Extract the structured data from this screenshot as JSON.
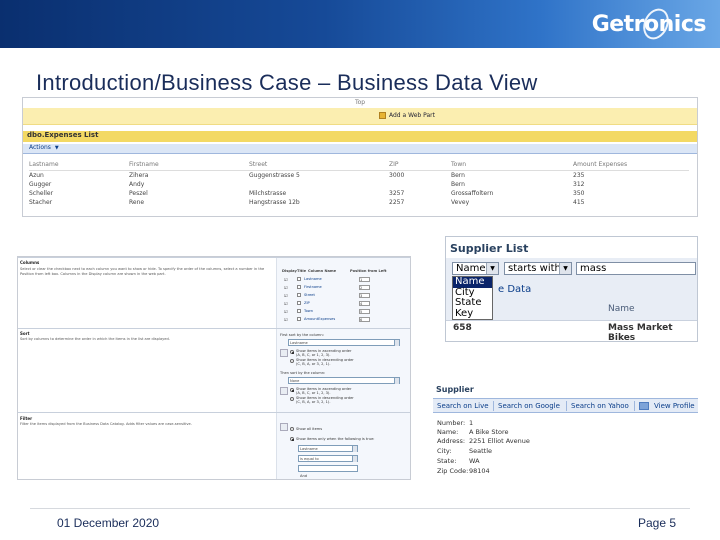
{
  "header": {
    "logo": "Getronics",
    "brand_color": "#164a98"
  },
  "slide": {
    "title": "Introduction/Business Case – Business Data View"
  },
  "expenses_panel": {
    "top_label": "Top",
    "add_webpart": "Add a Web Part",
    "list_title": "dbo.Expenses List",
    "actions": "Actions",
    "columns": [
      "Lastname",
      "Firstname",
      "Street",
      "ZIP",
      "Town",
      "Amount Expenses"
    ],
    "rows": [
      [
        "Azun",
        "Zihera",
        "Guggenstrasse 5",
        "3000",
        "Bern",
        "235"
      ],
      [
        "Gugger",
        "Andy",
        "",
        "",
        "Bern",
        "312"
      ],
      [
        "Scheller",
        "Peszel",
        "Milchstrasse",
        "3257",
        "Grossaffoltern",
        "350"
      ],
      [
        "Stacher",
        "Rene",
        "Hangstrasse 12b",
        "2257",
        "Vevey",
        "415"
      ]
    ]
  },
  "settings_panel": {
    "sec1_title": "Columns",
    "sec1_desc": "Select or clear the checkbox next to each column you want to show or hide. To specify the order of the columns, select a number in the Position from left box. Columns in the Display column are shown in the web part.",
    "col_headers": [
      "Display",
      "Title",
      "Column Name",
      "Position from Left"
    ],
    "columns": [
      {
        "name": "Lastname",
        "pos": "1"
      },
      {
        "name": "Firstname",
        "pos": "2"
      },
      {
        "name": "Street",
        "pos": "3"
      },
      {
        "name": "ZIP",
        "pos": "4"
      },
      {
        "name": "Town",
        "pos": "5"
      },
      {
        "name": "AmountExpenses",
        "pos": "6"
      }
    ],
    "sec2_title": "Sort",
    "sec2_desc": "Sort by columns to determine the order in which the items in the list are displayed.",
    "primary_label": "First sort by the column:",
    "primary_value": "Lastname",
    "asc_label": "Show items in ascending order (A, B, C, or 1, 2, 3).",
    "desc_label": "Show items in descending order (C, B, A, or 3, 2, 1).",
    "secondary_label": "Then sort by the column:",
    "secondary_value": "None",
    "sec3_title": "Filter",
    "sec3_desc": "Filter the items displayed from the Business Data Catalog. Adds filter values are case-sensitive.",
    "show_all": "Show all items",
    "show_when": "Show items only when the following is true:",
    "filter_col": "Lastname",
    "filter_op": "is equal to",
    "and_label": "And"
  },
  "supplier_list": {
    "title": "Supplier List",
    "field_select": "Name",
    "operator_select": "starts with",
    "search_value": "mass",
    "dropdown_options": [
      "Name",
      "City",
      "State",
      "Key"
    ],
    "datasource_label": "e Data",
    "column_name": "Name",
    "row_id": "658",
    "row_name": "Mass Market Bikes"
  },
  "supplier_detail": {
    "title": "Supplier",
    "links": [
      "Search on Live",
      "Search on Google",
      "Search on Yahoo",
      "View Profile"
    ],
    "fields": [
      {
        "label": "Number:",
        "value": "1"
      },
      {
        "label": "Name:",
        "value": "A Bike Store"
      },
      {
        "label": "Address:",
        "value": "2251 Elliot Avenue"
      },
      {
        "label": "City:",
        "value": "Seattle"
      },
      {
        "label": "State:",
        "value": "WA"
      },
      {
        "label": "Zip Code:",
        "value": "98104"
      }
    ]
  },
  "footer": {
    "date": "01 December 2020",
    "page": "Page 5"
  }
}
